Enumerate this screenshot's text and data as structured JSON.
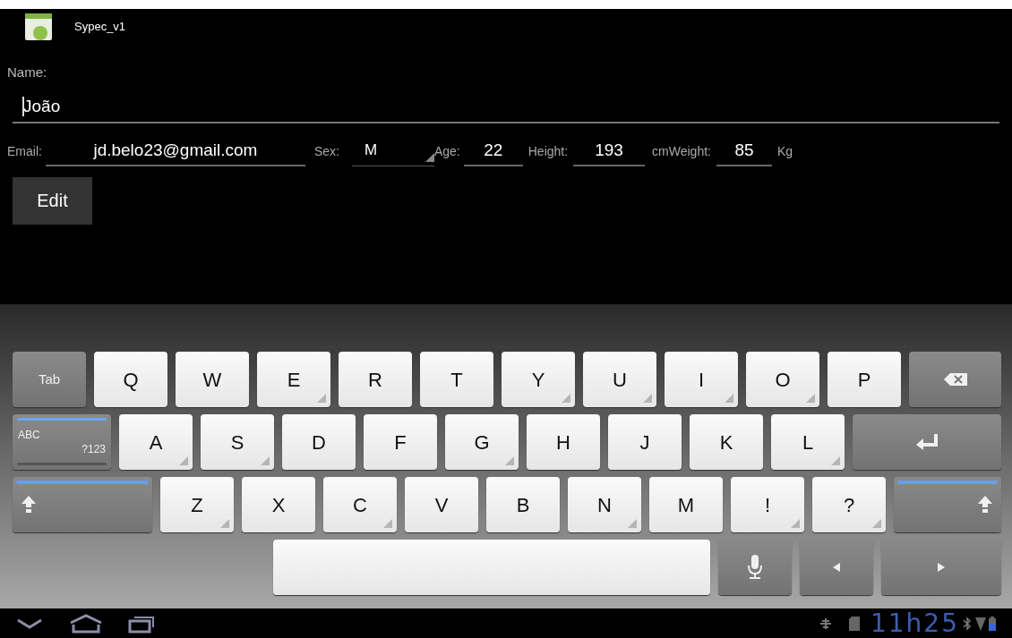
{
  "app_bar": {
    "title": "Sypec_v1"
  },
  "form": {
    "name_label": "Name:",
    "name_value": "João",
    "row": [
      {
        "kind": "label",
        "text": "Email:"
      },
      {
        "kind": "input",
        "text": "jd.belo23@gmail.com"
      },
      {
        "kind": "label",
        "text": "Sex:"
      },
      {
        "kind": "spinner",
        "text": "M"
      },
      {
        "kind": "label",
        "text": "Age:"
      },
      {
        "kind": "input",
        "text": "22"
      },
      {
        "kind": "label",
        "text": "Height:"
      },
      {
        "kind": "input",
        "text": "193"
      },
      {
        "kind": "label",
        "text": "cmWeight:"
      },
      {
        "kind": "input",
        "text": "85"
      },
      {
        "kind": "label",
        "text": "Kg"
      }
    ],
    "button": "Edit"
  },
  "keyboard": {
    "rows": [
      [
        {
          "kind": "tab",
          "label": "Tab"
        },
        {
          "kind": "char",
          "label": "Q",
          "popup": false
        },
        {
          "kind": "char",
          "label": "W",
          "popup": false
        },
        {
          "kind": "char",
          "label": "E",
          "popup": true
        },
        {
          "kind": "char",
          "label": "R",
          "popup": false
        },
        {
          "kind": "char",
          "label": "T",
          "popup": false
        },
        {
          "kind": "char",
          "label": "Y",
          "popup": true
        },
        {
          "kind": "char",
          "label": "U",
          "popup": true
        },
        {
          "kind": "char",
          "label": "I",
          "popup": true
        },
        {
          "kind": "char",
          "label": "O",
          "popup": true
        },
        {
          "kind": "char",
          "label": "P",
          "popup": false
        },
        {
          "kind": "backspace"
        }
      ],
      [
        {
          "kind": "mode",
          "label": "ABC",
          "alt_label": "?123",
          "on": true
        },
        {
          "kind": "char",
          "label": "A",
          "popup": true
        },
        {
          "kind": "char",
          "label": "S",
          "popup": true
        },
        {
          "kind": "char",
          "label": "D",
          "popup": false
        },
        {
          "kind": "char",
          "label": "F",
          "popup": false
        },
        {
          "kind": "char",
          "label": "G",
          "popup": true
        },
        {
          "kind": "char",
          "label": "H",
          "popup": false
        },
        {
          "kind": "char",
          "label": "J",
          "popup": false
        },
        {
          "kind": "char",
          "label": "K",
          "popup": false
        },
        {
          "kind": "char",
          "label": "L",
          "popup": true
        },
        {
          "kind": "enter"
        }
      ],
      [
        {
          "kind": "shift",
          "on": true
        },
        {
          "kind": "char",
          "label": "Z",
          "popup": true
        },
        {
          "kind": "char",
          "label": "X",
          "popup": false
        },
        {
          "kind": "char",
          "label": "C",
          "popup": true
        },
        {
          "kind": "char",
          "label": "V",
          "popup": false
        },
        {
          "kind": "char",
          "label": "B",
          "popup": false
        },
        {
          "kind": "char",
          "label": "N",
          "popup": true
        },
        {
          "kind": "char",
          "label": "M",
          "popup": false
        },
        {
          "kind": "char",
          "label": "!",
          "popup": true
        },
        {
          "kind": "char",
          "label": "?",
          "popup": true
        },
        {
          "kind": "shift",
          "on": true
        }
      ],
      [
        {
          "kind": "space"
        },
        {
          "kind": "mic"
        },
        {
          "kind": "left"
        },
        {
          "kind": "right"
        }
      ]
    ]
  },
  "status_bar": {
    "time": "11h25"
  }
}
